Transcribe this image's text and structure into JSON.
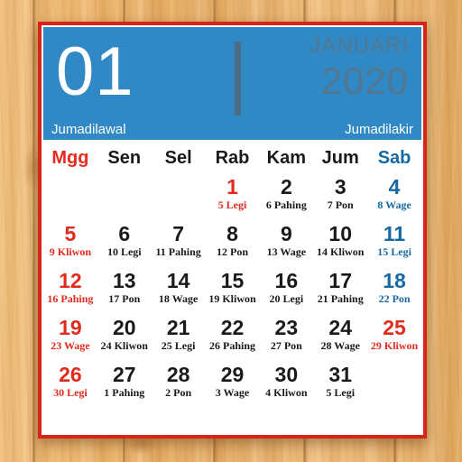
{
  "header": {
    "day_number": "01",
    "month": "JANUARI",
    "year": "2020",
    "javanese_month_start": "Jumadilawal",
    "javanese_month_end": "Jumadilakir"
  },
  "weekdays": [
    {
      "label": "Mgg",
      "tone": "red"
    },
    {
      "label": "Sen",
      "tone": "black"
    },
    {
      "label": "Sel",
      "tone": "black"
    },
    {
      "label": "Rab",
      "tone": "black"
    },
    {
      "label": "Kam",
      "tone": "black"
    },
    {
      "label": "Jum",
      "tone": "black"
    },
    {
      "label": "Sab",
      "tone": "blue"
    }
  ],
  "colors": {
    "header_blue": "#3089c4",
    "frame_red": "#d8251c",
    "sunday_red": "#e02b1d",
    "saturday_blue": "#1769a3",
    "month_year_gray": "#527792",
    "wood_background": "#e8b36a"
  },
  "dates": [
    {
      "day": "",
      "pasaran": "",
      "tone": "empty"
    },
    {
      "day": "",
      "pasaran": "",
      "tone": "empty"
    },
    {
      "day": "",
      "pasaran": "",
      "tone": "empty"
    },
    {
      "day": "1",
      "pasaran": "5 Legi",
      "tone": "red"
    },
    {
      "day": "2",
      "pasaran": "6 Pahing",
      "tone": "black"
    },
    {
      "day": "3",
      "pasaran": "7 Pon",
      "tone": "black"
    },
    {
      "day": "4",
      "pasaran": "8 Wage",
      "tone": "blue"
    },
    {
      "day": "5",
      "pasaran": "9 Kliwon",
      "tone": "red"
    },
    {
      "day": "6",
      "pasaran": "10 Legi",
      "tone": "black"
    },
    {
      "day": "7",
      "pasaran": "11 Pahing",
      "tone": "black"
    },
    {
      "day": "8",
      "pasaran": "12 Pon",
      "tone": "black"
    },
    {
      "day": "9",
      "pasaran": "13 Wage",
      "tone": "black"
    },
    {
      "day": "10",
      "pasaran": "14 Kliwon",
      "tone": "black"
    },
    {
      "day": "11",
      "pasaran": "15 Legi",
      "tone": "blue"
    },
    {
      "day": "12",
      "pasaran": "16 Pahing",
      "tone": "red"
    },
    {
      "day": "13",
      "pasaran": "17 Pon",
      "tone": "black"
    },
    {
      "day": "14",
      "pasaran": "18 Wage",
      "tone": "black"
    },
    {
      "day": "15",
      "pasaran": "19 Kliwon",
      "tone": "black"
    },
    {
      "day": "16",
      "pasaran": "20 Legi",
      "tone": "black"
    },
    {
      "day": "17",
      "pasaran": "21 Pahing",
      "tone": "black"
    },
    {
      "day": "18",
      "pasaran": "22 Pon",
      "tone": "blue"
    },
    {
      "day": "19",
      "pasaran": "23 Wage",
      "tone": "red"
    },
    {
      "day": "20",
      "pasaran": "24 Kliwon",
      "tone": "black"
    },
    {
      "day": "21",
      "pasaran": "25 Legi",
      "tone": "black"
    },
    {
      "day": "22",
      "pasaran": "26 Pahing",
      "tone": "black"
    },
    {
      "day": "23",
      "pasaran": "27 Pon",
      "tone": "black"
    },
    {
      "day": "24",
      "pasaran": "28 Wage",
      "tone": "black"
    },
    {
      "day": "25",
      "pasaran": "29 Kliwon",
      "tone": "red"
    },
    {
      "day": "26",
      "pasaran": "30 Legi",
      "tone": "red"
    },
    {
      "day": "27",
      "pasaran": "1 Pahing",
      "tone": "black"
    },
    {
      "day": "28",
      "pasaran": "2 Pon",
      "tone": "black"
    },
    {
      "day": "29",
      "pasaran": "3 Wage",
      "tone": "black"
    },
    {
      "day": "30",
      "pasaran": "4 Kliwon",
      "tone": "black"
    },
    {
      "day": "31",
      "pasaran": "5 Legi",
      "tone": "black"
    },
    {
      "day": "",
      "pasaran": "",
      "tone": "empty"
    }
  ]
}
